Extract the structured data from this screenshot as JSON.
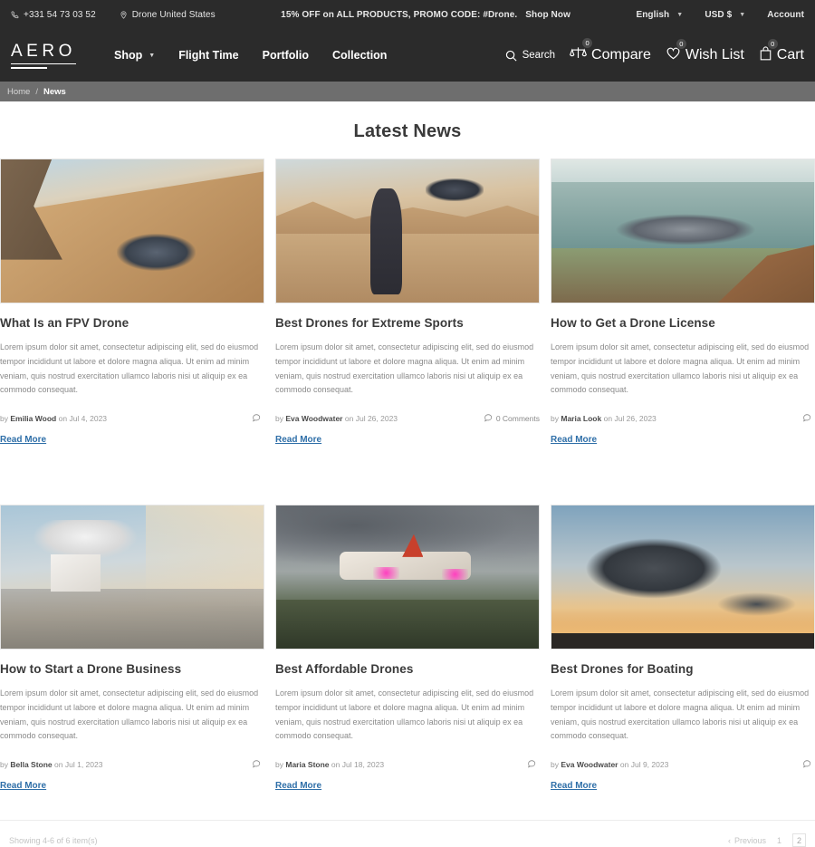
{
  "topbar": {
    "phone": "+331 54 73 03 52",
    "location": "Drone United States",
    "promo": "15% OFF on ALL PRODUCTS, PROMO CODE: #Drone.",
    "promo_cta": "Shop Now",
    "language": "English",
    "currency": "USD $",
    "account": "Account"
  },
  "header": {
    "logo": "AERO",
    "nav": [
      {
        "label": "Shop",
        "has_caret": true
      },
      {
        "label": "Flight Time",
        "has_caret": false
      },
      {
        "label": "Portfolio",
        "has_caret": false
      },
      {
        "label": "Collection",
        "has_caret": false
      }
    ],
    "actions": [
      {
        "label": "Search",
        "icon": "search-icon",
        "badge": null
      },
      {
        "label": "Compare",
        "icon": "compare-scale-icon",
        "badge": "0"
      },
      {
        "label": "Wish List",
        "icon": "heart-icon",
        "badge": "0"
      },
      {
        "label": "Cart",
        "icon": "shopping-bag-icon",
        "badge": "0"
      }
    ]
  },
  "breadcrumb": {
    "home": "Home",
    "separator": "/",
    "current": "News"
  },
  "page": {
    "title": "Latest News"
  },
  "articles": [
    {
      "title": "What Is an FPV Drone",
      "excerpt": "Lorem ipsum dolor sit amet, consectetur adipiscing elit, sed do eiusmod tempor incididunt ut labore et dolore magna aliqua. Ut enim ad minim veniam, quis nostrud exercitation ullamco laboris nisi ut aliquip ex ea commodo consequat.",
      "by": "by",
      "author": "Emilia Wood",
      "on": "on",
      "date": "Jul 4, 2023",
      "comments": "",
      "read_more": "Read More",
      "scene": "s1"
    },
    {
      "title": "Best Drones for Extreme Sports",
      "excerpt": "Lorem ipsum dolor sit amet, consectetur adipiscing elit, sed do eiusmod tempor incididunt ut labore et dolore magna aliqua. Ut enim ad minim veniam, quis nostrud exercitation ullamco laboris nisi ut aliquip ex ea commodo consequat.",
      "by": "by",
      "author": "Eva Woodwater",
      "on": "on",
      "date": "Jul 26, 2023",
      "comments": "0 Comments",
      "read_more": "Read More",
      "scene": "s2"
    },
    {
      "title": "How to Get a Drone License",
      "excerpt": "Lorem ipsum dolor sit amet, consectetur adipiscing elit, sed do eiusmod tempor incididunt ut labore et dolore magna aliqua. Ut enim ad minim veniam, quis nostrud exercitation ullamco laboris nisi ut aliquip ex ea commodo consequat.",
      "by": "by",
      "author": "Maria Look",
      "on": "on",
      "date": "Jul 26, 2023",
      "comments": "",
      "read_more": "Read More",
      "scene": "s3"
    },
    {
      "title": "How to Start a Drone Business",
      "excerpt": "Lorem ipsum dolor sit amet, consectetur adipiscing elit, sed do eiusmod tempor incididunt ut labore et dolore magna aliqua. Ut enim ad minim veniam, quis nostrud exercitation ullamco laboris nisi ut aliquip ex ea commodo consequat.",
      "by": "by",
      "author": "Bella Stone",
      "on": "on",
      "date": "Jul 1, 2023",
      "comments": "",
      "read_more": "Read More",
      "scene": "s4"
    },
    {
      "title": "Best Affordable Drones",
      "excerpt": "Lorem ipsum dolor sit amet, consectetur adipiscing elit, sed do eiusmod tempor incididunt ut labore et dolore magna aliqua. Ut enim ad minim veniam, quis nostrud exercitation ullamco laboris nisi ut aliquip ex ea commodo consequat.",
      "by": "by",
      "author": "Maria Stone",
      "on": "on",
      "date": "Jul 18, 2023",
      "comments": "",
      "read_more": "Read More",
      "scene": "s5"
    },
    {
      "title": "Best Drones for Boating",
      "excerpt": "Lorem ipsum dolor sit amet, consectetur adipiscing elit, sed do eiusmod tempor incididunt ut labore et dolore magna aliqua. Ut enim ad minim veniam, quis nostrud exercitation ullamco laboris nisi ut aliquip ex ea commodo consequat.",
      "by": "by",
      "author": "Eva Woodwater",
      "on": "on",
      "date": "Jul 9, 2023",
      "comments": "",
      "read_more": "Read More",
      "scene": "s6"
    }
  ],
  "footer": {
    "showing": "Showing 4-6 of 6 item(s)",
    "previous": "Previous",
    "pages": [
      "1",
      "2"
    ],
    "active_page": "2"
  },
  "colors": {
    "header_bg": "#2b2b2b",
    "breadcrumb_bg": "#6e6e6e",
    "link_blue": "#2f6fa8",
    "title_gray": "#3a3a3a",
    "body_gray": "#8a8a8a"
  }
}
